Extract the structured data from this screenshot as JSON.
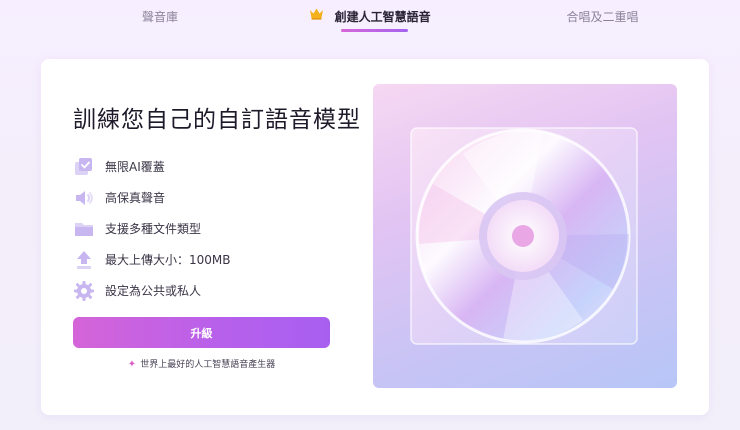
{
  "tabs": [
    {
      "label": "聲音庫",
      "active": false
    },
    {
      "label": "創建人工智慧語音",
      "active": true
    },
    {
      "label": "合唱及二重唱",
      "active": false
    }
  ],
  "card": {
    "title": "訓練您自己的自訂語音模型",
    "features": [
      {
        "icon": "ai-cover-icon",
        "label": "無限AI覆蓋"
      },
      {
        "icon": "speaker-icon",
        "label": "高保真聲音"
      },
      {
        "icon": "folder-icon",
        "label": "支援多種文件類型"
      },
      {
        "icon": "upload-arrow-icon",
        "label": "最大上傳大小：100MB"
      },
      {
        "icon": "gear-icon",
        "label": "設定為公共或私人"
      }
    ],
    "upgrade_label": "升級",
    "tagline": "世界上最好的人工智慧語音產生器"
  },
  "colors": {
    "accent_start": "#d564d8",
    "accent_end": "#a85ff0",
    "icon_tint": "#c9b8ee"
  }
}
